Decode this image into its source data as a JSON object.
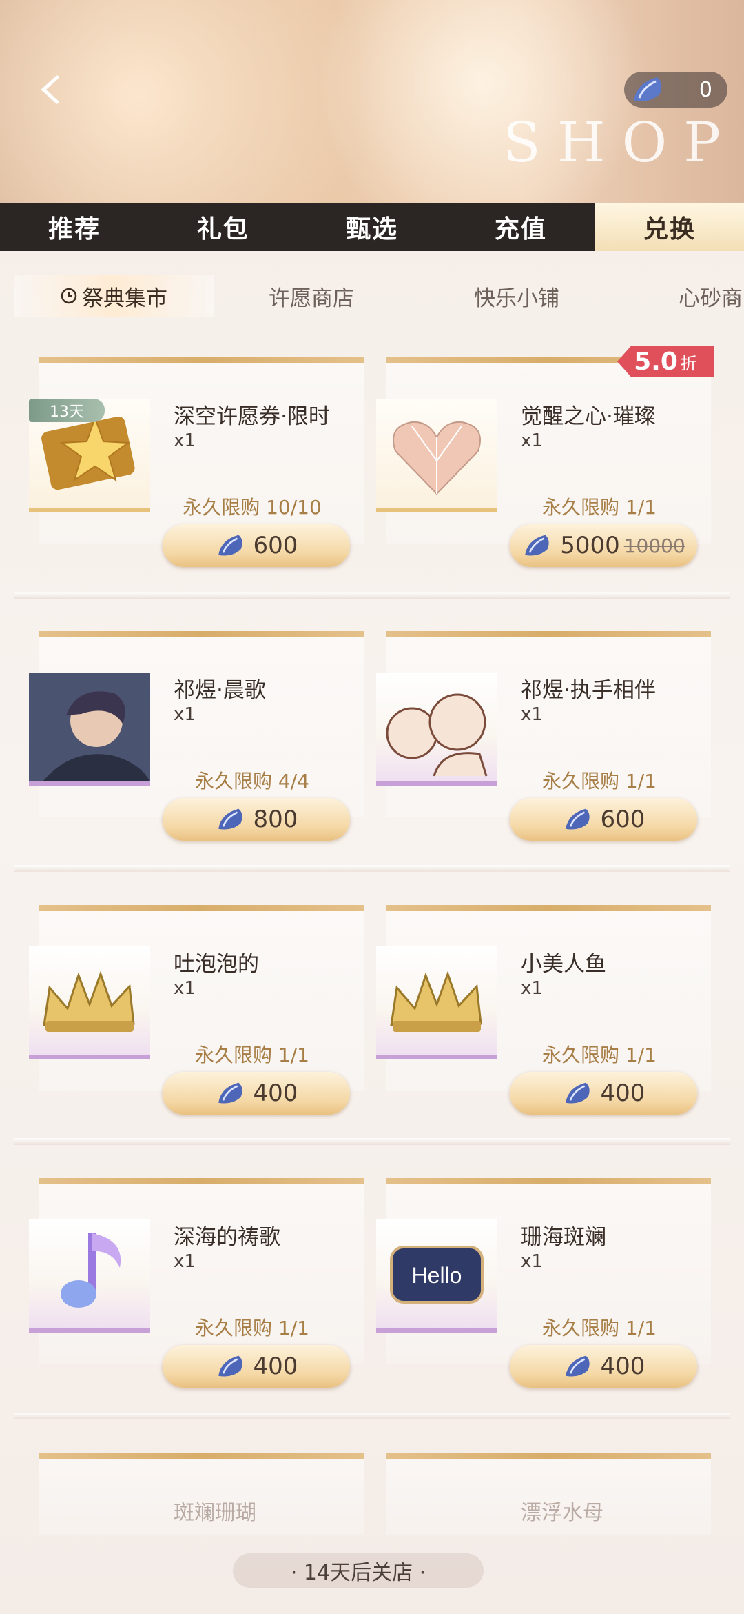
{
  "header": {
    "title": "SHOP",
    "currency_count": "0"
  },
  "main_tabs": [
    "推荐",
    "礼包",
    "甄选",
    "充值",
    "兑换"
  ],
  "sub_tabs": [
    "祭典集市",
    "许愿商店",
    "快乐小铺",
    "心砂商"
  ],
  "discount_badge": {
    "value": "5.0",
    "unit": "折"
  },
  "items": [
    {
      "name": "深空许愿券·限时",
      "qty": "x1",
      "limit": "永久限购 10/10",
      "price": "600",
      "timer": "13天"
    },
    {
      "name": "觉醒之心·璀璨",
      "qty": "x1",
      "limit": "永久限购 1/1",
      "price": "5000",
      "old_price": "10000"
    },
    {
      "name": "祁煜·晨歌",
      "qty": "x1",
      "limit": "永久限购 4/4",
      "price": "800"
    },
    {
      "name": "祁煜·执手相伴",
      "qty": "x1",
      "limit": "永久限购 1/1",
      "price": "600"
    },
    {
      "name": "吐泡泡的",
      "qty": "x1",
      "limit": "永久限购 1/1",
      "price": "400"
    },
    {
      "name": "小美人鱼",
      "qty": "x1",
      "limit": "永久限购 1/1",
      "price": "400"
    },
    {
      "name": "深海的祷歌",
      "qty": "x1",
      "limit": "永久限购 1/1",
      "price": "400"
    },
    {
      "name": "珊海斑斓",
      "qty": "x1",
      "limit": "永久限购 1/1",
      "price": "400",
      "thumb_text": "Hello"
    }
  ],
  "partial_items": [
    "斑斓珊瑚",
    "漂浮水母"
  ],
  "footer": "· 14天后关店 ·",
  "icons": {
    "back": "chevron-left-icon",
    "currency": "shell-icon",
    "clock": "clock-icon"
  }
}
